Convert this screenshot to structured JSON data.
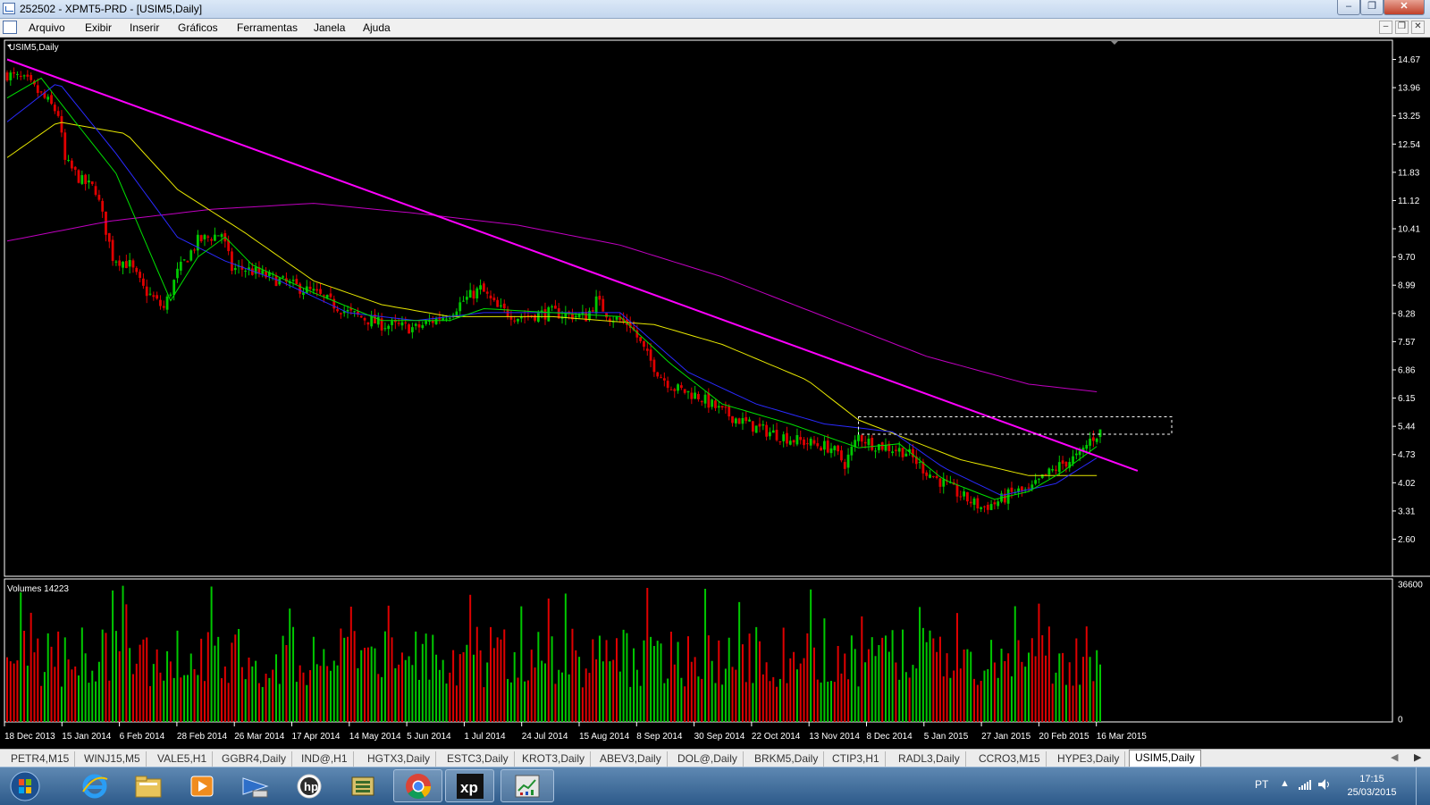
{
  "window": {
    "title": "252502 - XPMT5-PRD - [USIM5,Daily]"
  },
  "menu": {
    "items": [
      "Arquivo",
      "Exibir",
      "Inserir",
      "Gráficos",
      "Ferramentas",
      "Janela",
      "Ajuda"
    ]
  },
  "chart": {
    "symbol_label": "USIM5,Daily",
    "volume_label": "Volumes 14223",
    "price_ticks": [
      "14.67",
      "13.96",
      "13.25",
      "12.54",
      "11.83",
      "11.12",
      "10.41",
      "9.70",
      "8.99",
      "8.28",
      "7.57",
      "6.86",
      "6.15",
      "5.44",
      "4.73",
      "4.02",
      "3.31",
      "2.60"
    ],
    "volume_ticks": [
      "36600",
      "0"
    ],
    "date_ticks": [
      "18 Dec 2013",
      "15 Jan 2014",
      "6 Feb 2014",
      "28 Feb 2014",
      "26 Mar 2014",
      "17 Apr 2014",
      "14 May 2014",
      "5 Jun 2014",
      "1 Jul 2014",
      "24 Jul 2014",
      "15 Aug 2014",
      "8 Sep 2014",
      "30 Sep 2014",
      "22 Oct 2014",
      "13 Nov 2014",
      "8 Dec 2014",
      "5 Jan 2015",
      "27 Jan 2015",
      "20 Feb 2015",
      "16 Mar 2015"
    ],
    "colors": {
      "up": "#00c800",
      "down": "#e00000",
      "ma_fast": "#00e000",
      "ma_mid": "#2a2aff",
      "ma_slow": "#e8e800",
      "ma_long": "#c000c0",
      "trendline": "#ff00ff",
      "box": "#ffffff"
    }
  },
  "chart_data": {
    "type": "candlestick",
    "title": "USIM5,Daily",
    "ylim": [
      2.6,
      14.67
    ],
    "price_path": [
      [
        0,
        14.3
      ],
      [
        6,
        14.1
      ],
      [
        12,
        13.6
      ],
      [
        15,
        13.3
      ],
      [
        17,
        12.1
      ],
      [
        22,
        11.6
      ],
      [
        26,
        11.4
      ],
      [
        31,
        9.7
      ],
      [
        36,
        9.5
      ],
      [
        40,
        8.9
      ],
      [
        46,
        8.4
      ],
      [
        50,
        9.3
      ],
      [
        56,
        10.1
      ],
      [
        63,
        10.3
      ],
      [
        66,
        9.4
      ],
      [
        70,
        9.4
      ],
      [
        80,
        9.1
      ],
      [
        90,
        8.8
      ],
      [
        100,
        8.3
      ],
      [
        110,
        8.0
      ],
      [
        120,
        7.9
      ],
      [
        130,
        8.3
      ],
      [
        134,
        8.6
      ],
      [
        139,
        8.9
      ],
      [
        144,
        8.4
      ],
      [
        150,
        8.2
      ],
      [
        160,
        8.3
      ],
      [
        170,
        8.2
      ],
      [
        173,
        8.6
      ],
      [
        177,
        8.2
      ],
      [
        183,
        8.0
      ],
      [
        188,
        7.2
      ],
      [
        192,
        6.7
      ],
      [
        196,
        6.4
      ],
      [
        203,
        6.2
      ],
      [
        210,
        5.8
      ],
      [
        220,
        5.4
      ],
      [
        231,
        5.1
      ],
      [
        242,
        4.9
      ],
      [
        246,
        4.5
      ],
      [
        250,
        5.2
      ],
      [
        254,
        5.0
      ],
      [
        264,
        4.8
      ],
      [
        270,
        4.3
      ],
      [
        280,
        3.7
      ],
      [
        286,
        3.4
      ],
      [
        290,
        3.5
      ],
      [
        296,
        3.8
      ],
      [
        300,
        3.8
      ],
      [
        305,
        4.2
      ],
      [
        310,
        4.5
      ],
      [
        315,
        4.7
      ],
      [
        318,
        5.1
      ],
      [
        321,
        5.3
      ]
    ],
    "ma_fast": [
      [
        0,
        13.7
      ],
      [
        10,
        14.2
      ],
      [
        20,
        13.1
      ],
      [
        32,
        11.8
      ],
      [
        40,
        10.2
      ],
      [
        48,
        8.6
      ],
      [
        56,
        9.7
      ],
      [
        64,
        10.2
      ],
      [
        72,
        9.5
      ],
      [
        90,
        8.8
      ],
      [
        110,
        8.1
      ],
      [
        130,
        8.1
      ],
      [
        140,
        8.4
      ],
      [
        160,
        8.3
      ],
      [
        180,
        8.2
      ],
      [
        195,
        7.0
      ],
      [
        210,
        6.0
      ],
      [
        230,
        5.5
      ],
      [
        250,
        4.9
      ],
      [
        262,
        5.0
      ],
      [
        275,
        4.1
      ],
      [
        290,
        3.6
      ],
      [
        300,
        3.8
      ],
      [
        310,
        4.3
      ],
      [
        321,
        5.0
      ]
    ],
    "ma_mid": [
      [
        0,
        13.1
      ],
      [
        15,
        14.1
      ],
      [
        32,
        12.3
      ],
      [
        50,
        10.2
      ],
      [
        64,
        9.6
      ],
      [
        80,
        9.1
      ],
      [
        100,
        8.3
      ],
      [
        120,
        8.1
      ],
      [
        140,
        8.3
      ],
      [
        160,
        8.3
      ],
      [
        180,
        8.3
      ],
      [
        200,
        6.8
      ],
      [
        220,
        6.0
      ],
      [
        240,
        5.5
      ],
      [
        260,
        5.3
      ],
      [
        275,
        4.4
      ],
      [
        292,
        3.7
      ],
      [
        308,
        4.0
      ],
      [
        321,
        4.7
      ]
    ],
    "ma_slow": [
      [
        0,
        12.2
      ],
      [
        15,
        13.1
      ],
      [
        35,
        12.8
      ],
      [
        50,
        11.4
      ],
      [
        70,
        10.3
      ],
      [
        90,
        9.1
      ],
      [
        110,
        8.5
      ],
      [
        130,
        8.2
      ],
      [
        160,
        8.2
      ],
      [
        190,
        8.0
      ],
      [
        210,
        7.5
      ],
      [
        235,
        6.6
      ],
      [
        250,
        5.6
      ],
      [
        265,
        5.1
      ],
      [
        280,
        4.6
      ],
      [
        300,
        4.2
      ],
      [
        321,
        4.2
      ]
    ],
    "ma_long": [
      [
        0,
        10.1
      ],
      [
        30,
        10.6
      ],
      [
        60,
        10.9
      ],
      [
        90,
        11.05
      ],
      [
        120,
        10.8
      ],
      [
        150,
        10.5
      ],
      [
        180,
        10.0
      ],
      [
        210,
        9.2
      ],
      [
        240,
        8.2
      ],
      [
        270,
        7.2
      ],
      [
        300,
        6.5
      ],
      [
        321,
        6.3
      ]
    ],
    "trendline": [
      [
        0,
        14.67
      ],
      [
        332,
        4.32
      ]
    ],
    "resistance_box": {
      "x_start": 250,
      "x_end": 342,
      "price_top": 5.68,
      "price_bottom": 5.24
    },
    "volume_max": 36600,
    "volume_period": 14223
  },
  "tabs": [
    {
      "label": "PETR4,M15"
    },
    {
      "label": "WINJ15,M5"
    },
    {
      "label": "VALE5,H1"
    },
    {
      "label": "GGBR4,Daily"
    },
    {
      "label": "IND@,H1"
    },
    {
      "label": "HGTX3,Daily"
    },
    {
      "label": "ESTC3,Daily"
    },
    {
      "label": "KROT3,Daily"
    },
    {
      "label": "ABEV3,Daily"
    },
    {
      "label": "DOL@,Daily"
    },
    {
      "label": "BRKM5,Daily"
    },
    {
      "label": "CTIP3,H1"
    },
    {
      "label": "RADL3,Daily"
    },
    {
      "label": "CCRO3,M15"
    },
    {
      "label": "HYPE3,Daily"
    },
    {
      "label": "USIM5,Daily",
      "active": true
    }
  ],
  "taskbar": {
    "apps": [
      {
        "icon": "start-orb-icon"
      },
      {
        "icon": "internet-explorer-icon"
      },
      {
        "icon": "file-explorer-icon"
      },
      {
        "icon": "media-player-icon"
      },
      {
        "icon": "network-icon"
      },
      {
        "icon": "hp-icon"
      },
      {
        "icon": "archive-tool-icon"
      },
      {
        "icon": "chrome-icon"
      },
      {
        "icon": "xp-app-icon"
      },
      {
        "icon": "metatrader-icon"
      }
    ],
    "language": "PT",
    "time": "17:15",
    "date": "25/03/2015"
  }
}
